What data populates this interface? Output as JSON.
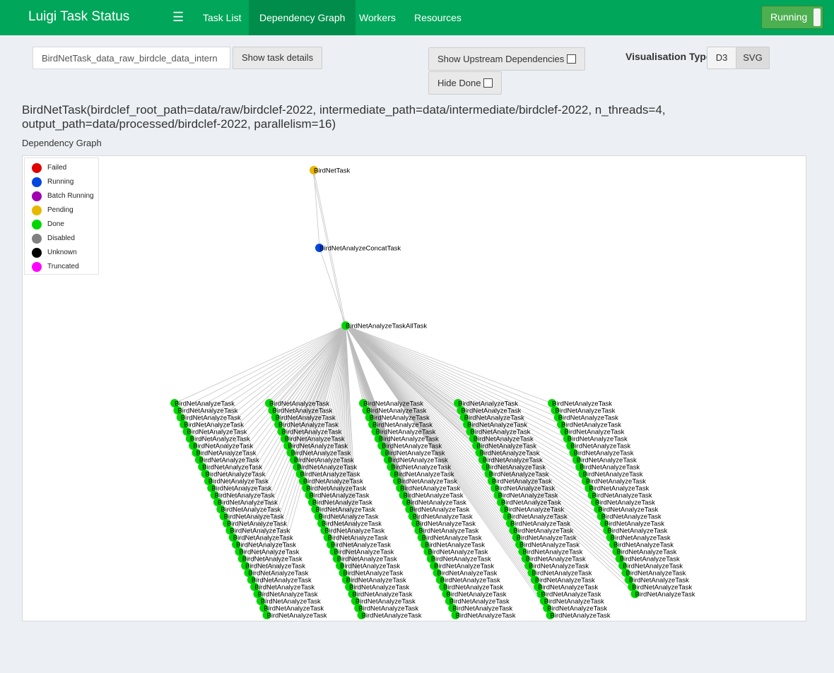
{
  "app": {
    "title": "Luigi Task Status"
  },
  "nav": {
    "menu_icon": "hamburger-icon",
    "links": [
      {
        "label": "Task List",
        "active": false
      },
      {
        "label": "Dependency Graph",
        "active": true
      },
      {
        "label": "Workers",
        "active": false
      },
      {
        "label": "Resources",
        "active": false
      }
    ],
    "status_toggle": "Running"
  },
  "search": {
    "value": "BirdNetTask_data_raw_birdcle_data_intern"
  },
  "buttons": {
    "show_details": "Show task details",
    "show_upstream": "Show Upstream Dependencies",
    "hide_done": "Hide Done"
  },
  "visualisation": {
    "label": "Visualisation Type",
    "options": [
      "D3",
      "SVG"
    ],
    "selected": "SVG"
  },
  "task": {
    "title_line1": "BirdNetTask(birdclef_root_path=data/raw/birdclef-2022, intermediate_path=data/intermediate/birdclef-2022, n_threads=4,",
    "title_line2": "output_path=data/processed/birdclef-2022, parallelism=16)"
  },
  "graph": {
    "label": "Dependency Graph",
    "legend": [
      {
        "label": "Failed",
        "color": "#e00000"
      },
      {
        "label": "Running",
        "color": "#0046e0"
      },
      {
        "label": "Batch Running",
        "color": "#a000b0"
      },
      {
        "label": "Pending",
        "color": "#e8b800"
      },
      {
        "label": "Done",
        "color": "#00d700"
      },
      {
        "label": "Disabled",
        "color": "#808080"
      },
      {
        "label": "Unknown",
        "color": "#000000"
      },
      {
        "label": "Truncated",
        "color": "#ff00ff"
      }
    ],
    "nodes_top": [
      {
        "name": "BirdNetTask",
        "status": "Pending"
      },
      {
        "name": "BirdNetAnalyzeConcatTask",
        "status": "Running"
      },
      {
        "name": "BirdNetAnalyzeTaskAllTask",
        "status": "Done"
      }
    ],
    "leaf_columns": [
      {
        "count": 31,
        "name": "BirdNetAnalyzeTask",
        "status": "Done"
      },
      {
        "count": 31,
        "name": "BirdNetAnalyzeTask",
        "status": "Done"
      },
      {
        "count": 31,
        "name": "BirdNetAnalyzeTask",
        "status": "Done"
      },
      {
        "count": 31,
        "name": "BirdNetAnalyzeTask",
        "status": "Done"
      },
      {
        "count": 28,
        "name": "BirdNetAnalyzeTask",
        "status": "Done"
      }
    ]
  }
}
